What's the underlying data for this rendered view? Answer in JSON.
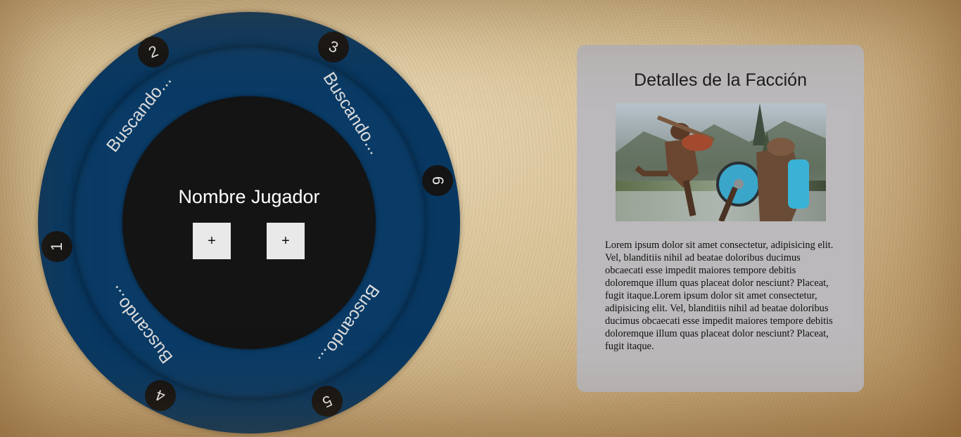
{
  "board": {
    "player_name": "Nombre Jugador",
    "add_button_left": "+",
    "add_button_right": "+",
    "seats": [
      {
        "number": "1",
        "status": "Buscando..."
      },
      {
        "number": "2",
        "status": "Buscando..."
      },
      {
        "number": "3",
        "status": "Buscando..."
      },
      {
        "number": "4",
        "status": "Buscando..."
      },
      {
        "number": "5",
        "status": "Buscando..."
      },
      {
        "number": "6",
        "status": "Buscando..."
      }
    ]
  },
  "faction_panel": {
    "title": "Detalles de la Facción",
    "image_icon": "warriors-battle-image",
    "description": "Lorem ipsum dolor sit amet consectetur, adipisicing elit. Vel, blanditiis nihil ad beatae doloribus ducimus obcaecati esse impedit maiores tempore debitis doloremque illum quas placeat dolor nesciunt? Placeat, fugit itaque.Lorem ipsum dolor sit amet consectetur, adipisicing elit. Vel, blanditiis nihil ad beatae doloribus ducimus obcaecati esse impedit maiores tempore debitis doloremque illum quas placeat dolor nesciunt? Placeat, fugit itaque."
  },
  "colors": {
    "wheel_blue": "#083862",
    "center_black": "#141414",
    "panel_gray": "#bbb9bb",
    "parchment": "#cdb587"
  }
}
